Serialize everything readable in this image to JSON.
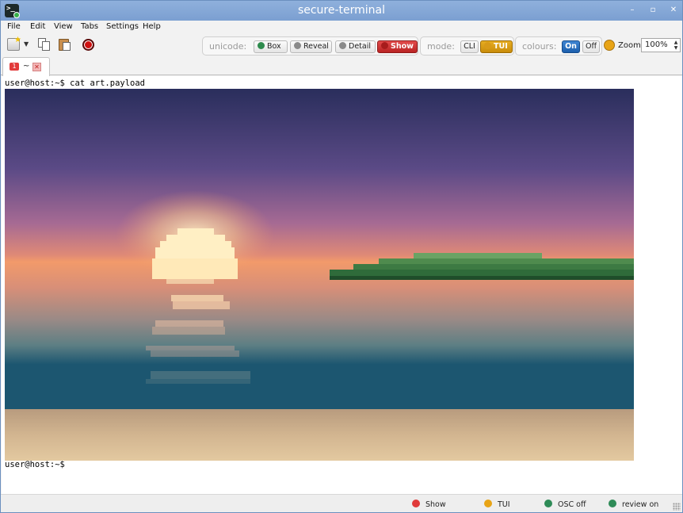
{
  "window": {
    "title": "secure-terminal",
    "controls": {
      "minimize": "–",
      "maximize": "▫",
      "close": "✕"
    }
  },
  "menu": [
    {
      "label": "File"
    },
    {
      "label": "Edit"
    },
    {
      "label": "View"
    },
    {
      "label": "Tabs"
    },
    {
      "label": "Settings"
    },
    {
      "label": "Help"
    }
  ],
  "toolbar": {
    "icons": [
      "new-tab-icon",
      "dropdown-arrow-icon",
      "copy-icon",
      "paste-icon",
      "record-icon"
    ],
    "unicode": {
      "label": "unicode:",
      "options": [
        {
          "label": "Box",
          "dot_color": "#2e8b4d"
        },
        {
          "label": "Reveal",
          "dot_color": "#8a8a8a"
        },
        {
          "label": "Detail",
          "dot_color": "#8a8a8a"
        },
        {
          "label": "Show",
          "active": true
        }
      ]
    },
    "mode": {
      "label": "mode:",
      "options": [
        {
          "label": "CLI"
        },
        {
          "label": "TUI",
          "active": true
        }
      ]
    },
    "colours": {
      "label": "colours:",
      "options": [
        {
          "label": "On",
          "active": true
        },
        {
          "label": "Off"
        }
      ]
    },
    "zoom": {
      "label": "Zoom",
      "value": "100%"
    }
  },
  "tabs": [
    {
      "number": "1",
      "title": "~",
      "close": "✕"
    }
  ],
  "terminal": {
    "command_line": "user@host:~$ cat art.payload",
    "prompt_line": "user@host:~$",
    "art_icon": "pixel-art-sunset-image"
  },
  "status": [
    {
      "label": "Show",
      "color": "#e03a3a"
    },
    {
      "label": "TUI",
      "color": "#e8a416"
    },
    {
      "label": "OSC off",
      "color": "#2e8b57"
    },
    {
      "label": "review on",
      "color": "#2e8b57"
    }
  ],
  "colors": {
    "titlebar": "#85a7d6",
    "accent_red": "#d12b2b",
    "accent_amber": "#e0a117",
    "accent_blue": "#2a6fbf"
  }
}
